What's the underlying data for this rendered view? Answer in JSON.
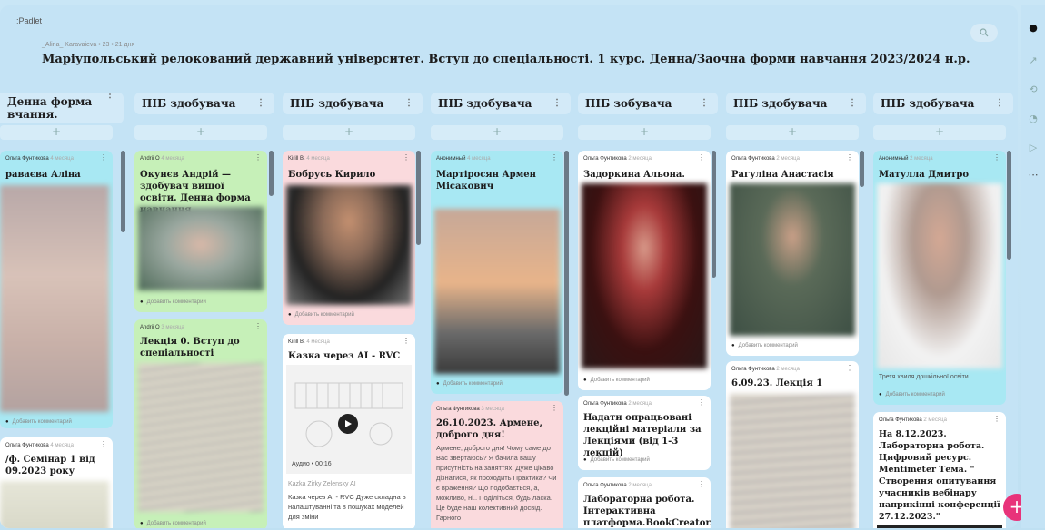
{
  "app": {
    "brand": ":Padlet"
  },
  "header": {
    "meta": "_Alina_ Karavaieva • 23 • 21 дня",
    "title": "Маріупольський релокований державний університет. Вступ до спеціальності. 1 курс. Денна/Заочна форми навчання 2023/2024 н.р."
  },
  "columns": [
    {
      "title": "Денна форма",
      "title2": "вчання."
    },
    {
      "title": "ПІБ здобувача"
    },
    {
      "title": "ПІБ здобувача"
    },
    {
      "title": "ПІБ здобувача"
    },
    {
      "title": "ПІБ зобувача"
    },
    {
      "title": "ПІБ здобувача"
    },
    {
      "title": "ПІБ здобувача"
    }
  ],
  "add_symbol": "+",
  "comment_label": "Добавить комментарий",
  "cards": {
    "c0a": {
      "author": "Ольга Фунтикова",
      "ago": "4 месяца",
      "title": "раваєва Аліна"
    },
    "c0b": {
      "author": "Ольга Фунтикова",
      "ago": "4 месяца",
      "title": "/ф. Семінар 1 від",
      "title2": "09.2023 року"
    },
    "c1a": {
      "author": "Andrii O",
      "ago": "4 месяца",
      "title": "Окунєв Андрій — здобувач вищої освіти. Денна форма навчання"
    },
    "c1b": {
      "author": "Andrii O",
      "ago": "3 месяца",
      "title": "Лекція 0. Вступ до спеціальності"
    },
    "c2a": {
      "author": "Kirill B.",
      "ago": "4 месяца",
      "title": "Бобрусь Кирило"
    },
    "c2b": {
      "author": "Kirill B.",
      "ago": "4 месяца",
      "title": "Казка через AI - RVC",
      "audio": "Аудио • 00:16",
      "source": "Kazka Zirky Zelensky AI",
      "body": "Казка через AI - RVC Дуже складна в налаштуванні та в пошуках моделей для зміни"
    },
    "c3a": {
      "author": "Анонимный",
      "ago": "4 месяца",
      "title": "Мартіросян Армен Місакович"
    },
    "c3b": {
      "author": "Ольга Фунтикова",
      "ago": "3 месяца",
      "title": "26.10.2023. Армене, доброго дня!",
      "body": "Армене, доброго дня! Чому саме до Вас звертаюсь? Я бачила вашу присутність на заняттях. Дуже цікаво дізнатися, як проходить Практика? Чи є враження? Що подобається, а, можливо, ні.. Поділіться, будь ласка. Це буде наш колективний досвід. Гарного"
    },
    "c4a": {
      "author": "Ольга Фунтикова",
      "ago": "2 месяца",
      "title": "Задоркина Альона."
    },
    "c4b": {
      "author": "Ольга Фунтикова",
      "ago": "2 месяца",
      "title": "Надати опрацьовані лекційні матеріали за Лекціями (від 1-3 лекцій)"
    },
    "c4c": {
      "author": "Ольга Фунтикова",
      "ago": "2 месяца",
      "title": "Лабораторна робота. Інтерактивна платформа.BookCreator."
    },
    "c5a": {
      "author": "Ольга Фунтикова",
      "ago": "2 месяца",
      "title": "Рагуліна Анастасія"
    },
    "c5b": {
      "author": "Ольга Фунтикова",
      "ago": "2 месяца",
      "title": "6.09.23. Лекція 1"
    },
    "c6a": {
      "author": "Анонимный",
      "ago": "2 месяца",
      "title": "Матулла Дмитро",
      "caption": "Третя хвиля дошкільної освіти"
    },
    "c6b": {
      "author": "Ольга Фунтикова",
      "ago": "2 месяца",
      "title": "На 8.12.2023. Лабораторна робота. Цифровий ресурс. Mentimeter Тема. \" Створення опитування учасників вебінару наприкінці конференції 27.12.2023.\""
    }
  },
  "colors": {
    "accent": "#e8337a",
    "card_cyan": "#a8e8f3",
    "card_green": "#c6f0b8",
    "card_pink": "#fadadd",
    "card_white": "#ffffff"
  }
}
